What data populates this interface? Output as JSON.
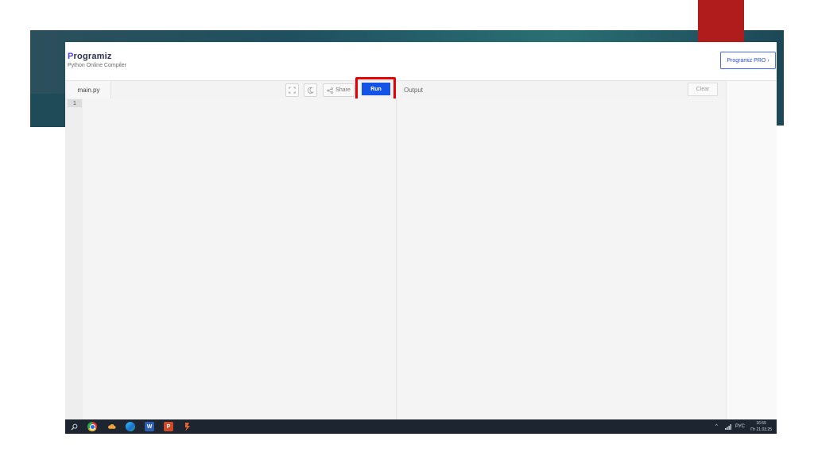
{
  "header": {
    "logo_initial": "P",
    "logo_rest": "rogramiz",
    "subtitle": "Python Online Compiler",
    "pro_button": "Programiz PRO ›"
  },
  "toolbar": {
    "file_tab": "main.py",
    "share_label": "Share",
    "run_label": "Run",
    "output_label": "Output",
    "clear_label": "Clear"
  },
  "editor": {
    "line_numbers": [
      "1"
    ]
  },
  "taskbar": {
    "language": "РУС",
    "time": "16:55",
    "date": "Пт 21.03.25"
  },
  "colors": {
    "run_button": "#1453e8",
    "highlight": "#e80000",
    "slide_red": "#b01c1c",
    "slide_band": "#1f5060"
  }
}
